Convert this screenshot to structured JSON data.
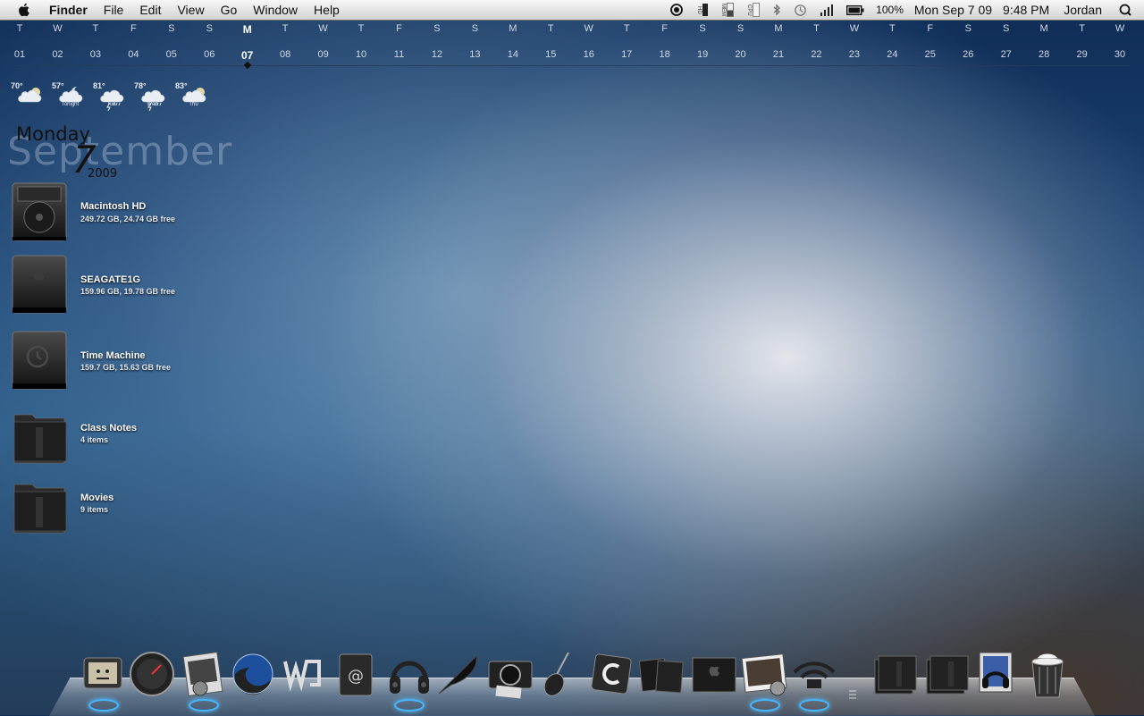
{
  "menubar": {
    "app_name": "Finder",
    "menus": [
      "File",
      "Edit",
      "View",
      "Go",
      "Window",
      "Help"
    ],
    "status": {
      "hd_label": "HD",
      "mem_label": "MEM",
      "cpu_label": "CPU",
      "battery_percent": "100%",
      "datetime": "Mon Sep 7 09",
      "time": "9:48 PM",
      "user": "Jordan"
    },
    "icons": [
      "apple-icon",
      "record-icon",
      "bluetooth-icon",
      "time-machine-icon",
      "signal-icon",
      "battery-icon",
      "spotlight-icon"
    ]
  },
  "calendar": {
    "today_index": 6,
    "days": [
      {
        "dow": "T",
        "num": "01"
      },
      {
        "dow": "W",
        "num": "02"
      },
      {
        "dow": "T",
        "num": "03"
      },
      {
        "dow": "F",
        "num": "04"
      },
      {
        "dow": "S",
        "num": "05"
      },
      {
        "dow": "S",
        "num": "06"
      },
      {
        "dow": "M",
        "num": "07"
      },
      {
        "dow": "T",
        "num": "08"
      },
      {
        "dow": "W",
        "num": "09"
      },
      {
        "dow": "T",
        "num": "10"
      },
      {
        "dow": "F",
        "num": "11"
      },
      {
        "dow": "S",
        "num": "12"
      },
      {
        "dow": "S",
        "num": "13"
      },
      {
        "dow": "M",
        "num": "14"
      },
      {
        "dow": "T",
        "num": "15"
      },
      {
        "dow": "W",
        "num": "16"
      },
      {
        "dow": "T",
        "num": "17"
      },
      {
        "dow": "F",
        "num": "18"
      },
      {
        "dow": "S",
        "num": "19"
      },
      {
        "dow": "S",
        "num": "20"
      },
      {
        "dow": "M",
        "num": "21"
      },
      {
        "dow": "T",
        "num": "22"
      },
      {
        "dow": "W",
        "num": "23"
      },
      {
        "dow": "T",
        "num": "24"
      },
      {
        "dow": "F",
        "num": "25"
      },
      {
        "dow": "S",
        "num": "26"
      },
      {
        "dow": "S",
        "num": "27"
      },
      {
        "dow": "M",
        "num": "28"
      },
      {
        "dow": "T",
        "num": "29"
      },
      {
        "dow": "W",
        "num": "30"
      }
    ]
  },
  "weather": [
    {
      "temp": "70°",
      "label": "",
      "icon": "partly-cloudy-icon"
    },
    {
      "temp": "57°",
      "label": "Tonight",
      "icon": "moon-cloud-icon"
    },
    {
      "temp": "81°",
      "label": "Tue",
      "icon": "thunderstorm-icon"
    },
    {
      "temp": "78°",
      "label": "Wed",
      "icon": "thunderstorm-icon"
    },
    {
      "temp": "83°",
      "label": "Thu",
      "icon": "partly-cloudy-icon"
    }
  ],
  "date_widget": {
    "month": "September",
    "weekday": "Monday",
    "day": "7",
    "year": "2009"
  },
  "desktop_items": [
    {
      "name": "Macintosh HD",
      "info": "249.72 GB, 24.74 GB free",
      "icon": "hard-drive-icon"
    },
    {
      "name": "SEAGATE1G",
      "info": "159.96 GB, 19.78 GB free",
      "icon": "external-drive-icon"
    },
    {
      "name": "Time Machine",
      "info": "159.7 GB, 15.63 GB free",
      "icon": "time-machine-drive-icon"
    },
    {
      "name": "Class Notes",
      "info": "4 items",
      "icon": "folder-icon"
    },
    {
      "name": "Movies",
      "info": "9 items",
      "icon": "folder-icon"
    }
  ],
  "dock": {
    "items": [
      {
        "name": "tv-app-icon",
        "running": true
      },
      {
        "name": "dashboard-icon",
        "running": false
      },
      {
        "name": "preview-app-icon",
        "running": true
      },
      {
        "name": "firefox-icon",
        "running": false
      },
      {
        "name": "word-app-icon",
        "running": false
      },
      {
        "name": "address-book-icon",
        "running": false
      },
      {
        "name": "headphones-itunes-icon",
        "running": true
      },
      {
        "name": "feather-icon",
        "running": false
      },
      {
        "name": "camera-icon",
        "running": false
      },
      {
        "name": "guitar-garageband-icon",
        "running": false
      },
      {
        "name": "c-app-icon",
        "running": false
      },
      {
        "name": "black-boxes-icon",
        "running": false
      },
      {
        "name": "apple-box-icon",
        "running": false
      },
      {
        "name": "iphoto-icon",
        "running": true
      },
      {
        "name": "wifi-icon",
        "running": true
      },
      {
        "name": "documents-stack-icon",
        "running": false
      },
      {
        "name": "downloads-stack-icon",
        "running": false
      },
      {
        "name": "music-stack-icon",
        "running": false
      },
      {
        "name": "trash-icon",
        "running": false
      }
    ]
  }
}
